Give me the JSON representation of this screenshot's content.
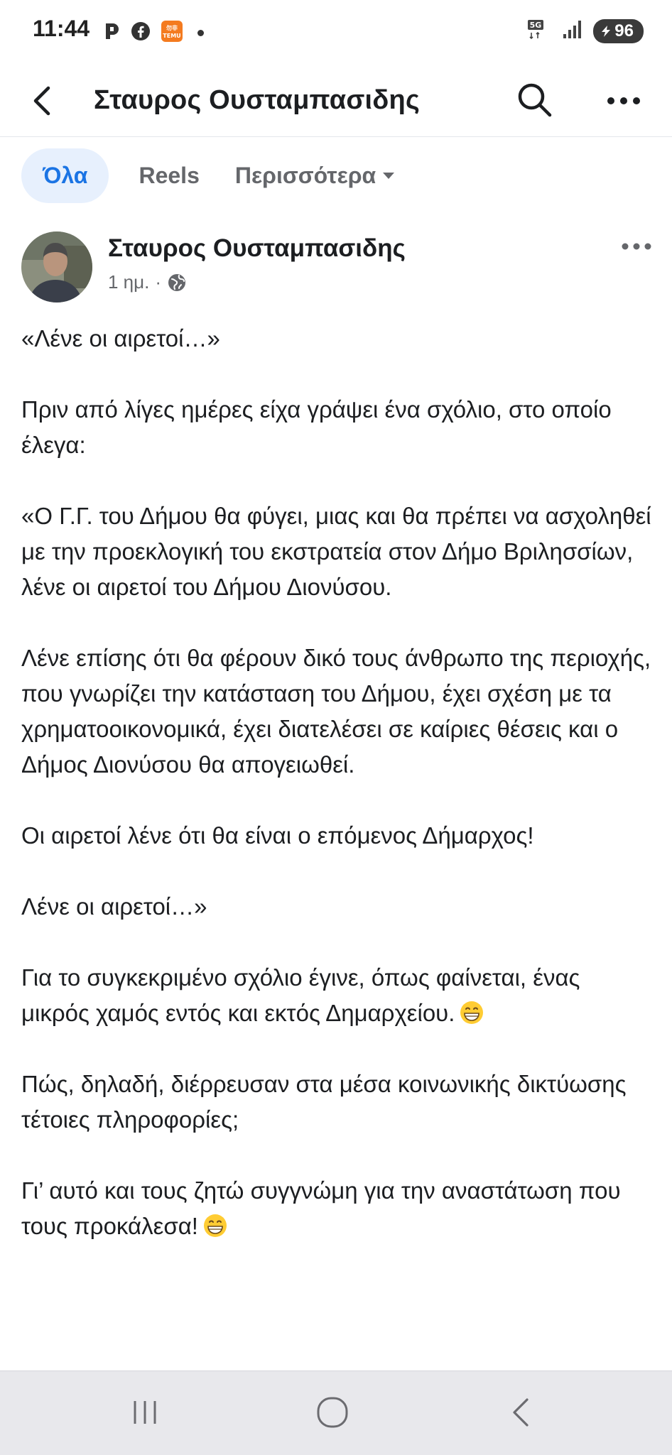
{
  "status_bar": {
    "time": "11:44",
    "left_icons": [
      "app-notification-icon",
      "facebook-icon",
      "temu-icon"
    ],
    "network": "5G",
    "battery": "96"
  },
  "app_bar": {
    "title": "Σταυρος Ουσταμπασιδης",
    "icons": [
      "back-arrow-icon",
      "search-icon",
      "more-options-icon"
    ]
  },
  "tabs": {
    "all": "Όλα",
    "reels": "Reels",
    "more": "Περισσότερα"
  },
  "post": {
    "author": "Σταυρος Ουσταμπασιδης",
    "time": "1 ημ.",
    "separator": "·",
    "audience_icon": "globe-icon",
    "paragraphs": [
      "«Λένε οι αιρετοί…»",
      "Πριν από λίγες ημέρες είχα γράψει ένα σχόλιο, στο οποίο έλεγα:",
      "«Ο Γ.Γ. του Δήμου θα φύγει, μιας και θα πρέπει να ασχοληθεί με την προεκλογική του εκστρατεία στον Δήμο Βριλησσίων, λένε οι αιρετοί του Δήμου Διονύσου.",
      "Λένε επίσης ότι θα φέρουν δικό τους άνθρωπο της περιοχής, που γνωρίζει την κατάσταση του Δήμου, έχει σχέση με τα χρηματοοικονομικά, έχει διατελέσει σε καίριες θέσεις και ο Δήμος Διονύσου θα απογειωθεί.",
      "Οι αιρετοί λένε ότι θα είναι ο επόμενος Δήμαρχος!",
      "Λένε οι αιρετοί…»",
      "Για το συγκεκριμένο σχόλιο έγινε, όπως φαίνεται, ένας μικρός χαμός εντός και εκτός Δημαρχείου.",
      "Πώς, δηλαδή, διέρρευσαν στα μέσα κοινωνικής δικτύωσης τέτοιες πληροφορίες;",
      "Γι’ αυτό και τους ζητώ συγγνώμη για την αναστάτωση που τους προκάλεσα!"
    ]
  },
  "nav_bar": {
    "icons": [
      "recent-apps-icon",
      "home-icon",
      "back-icon"
    ]
  },
  "colors": {
    "accent": "#1b74e4",
    "tab_active_bg": "#e7f0fd",
    "text": "#1c1e21",
    "muted": "#65676b",
    "navbar_bg": "#e8e8ec"
  }
}
